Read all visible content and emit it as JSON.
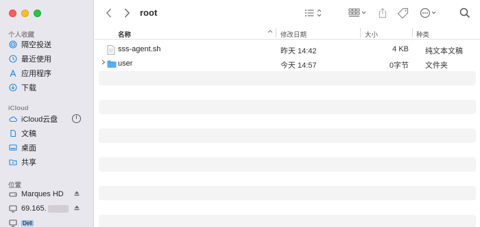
{
  "sidebar": {
    "favorites_title": "个人收藏",
    "favorites": [
      {
        "label": "隔空投送",
        "icon": "airdrop-icon"
      },
      {
        "label": "最近使用",
        "icon": "clock-icon"
      },
      {
        "label": "应用程序",
        "icon": "applications-icon"
      },
      {
        "label": "下载",
        "icon": "download-icon"
      }
    ],
    "icloud_title": "iCloud",
    "icloud": [
      {
        "label": "iCloud云盘",
        "icon": "cloud-icon"
      },
      {
        "label": "文稿",
        "icon": "document-icon"
      },
      {
        "label": "桌面",
        "icon": "desktop-icon"
      },
      {
        "label": "共享",
        "icon": "shared-folder-icon"
      }
    ],
    "locations_title": "位置",
    "locations": [
      {
        "label": "Marques HD",
        "icon": "drive-icon"
      },
      {
        "label": "69.165.",
        "icon": "network-display-icon"
      },
      {
        "label": "Dell",
        "icon": "display-icon"
      }
    ]
  },
  "toolbar": {
    "folder_title": "root"
  },
  "columns": {
    "name": "名称",
    "date": "修改日期",
    "size": "大小",
    "kind": "种类"
  },
  "files": [
    {
      "name": "sss-agent.sh",
      "date": "昨天 14:42",
      "size": "4 KB",
      "kind": "纯文本文稿",
      "type": "file"
    },
    {
      "name": "user",
      "date": "今天 14:57",
      "size": "0字节",
      "kind": "文件夹",
      "type": "folder"
    }
  ],
  "colors": {
    "sidebar_bg": "#e9e7ee",
    "accent": "#1e88e5",
    "folder": "#5aaef5"
  }
}
